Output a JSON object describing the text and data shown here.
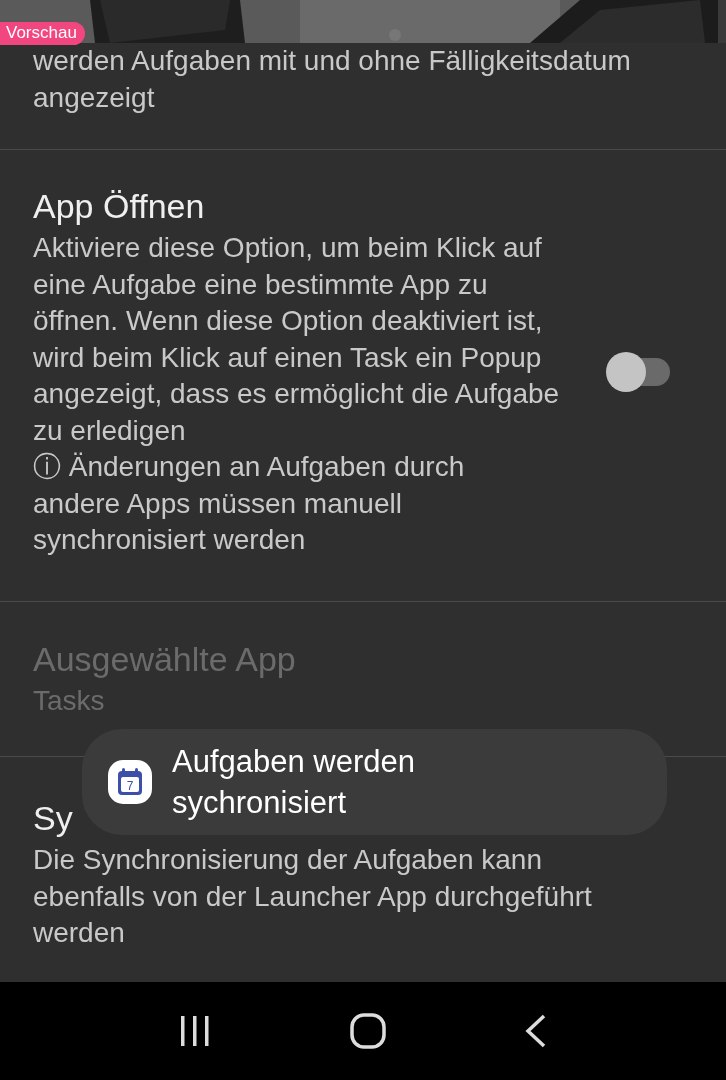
{
  "header": {
    "badge": "Vorschau"
  },
  "settings": [
    {
      "kind": "continuation",
      "description": "werden Aufgaben mit und ohne Fälligkeitsdatum angezeigt"
    },
    {
      "kind": "toggle",
      "title": "App Öffnen",
      "description": "Aktiviere diese Option, um beim Klick auf eine Aufgabe eine bestimmte App zu öffnen. Wenn diese Option deaktiviert ist, wird beim Klick auf einen Task ein Popup angezeigt, dass es ermöglicht die Aufgabe zu erledigen",
      "note_icon": "ⓘ",
      "note": "Änderungen an Aufgaben durch andere Apps müssen manuell synchronisiert werden",
      "on": false
    },
    {
      "kind": "value",
      "title": "Ausgewählte App",
      "value": "Tasks",
      "disabled": true
    },
    {
      "kind": "info",
      "title": "Sy",
      "description": "Die Synchronisierung der Aufgaben kann ebenfalls von der Launcher App durchgeführt werden"
    }
  ],
  "toast": {
    "icon_text": "7",
    "message": "Aufgaben werden sychronisiert"
  }
}
